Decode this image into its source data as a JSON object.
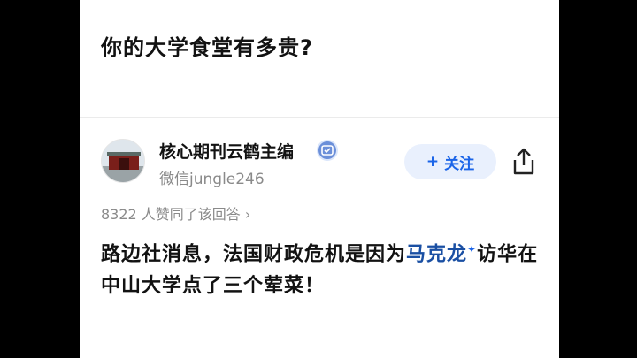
{
  "question": {
    "title": "你的大学食堂有多贵?"
  },
  "author": {
    "name": "核心期刊云鹤主编",
    "handle": "微信jungle246",
    "verified_icon": "verified-badge-icon"
  },
  "actions": {
    "follow_plus": "+",
    "follow_label": "关注",
    "share_icon": "share-icon"
  },
  "stats": {
    "upvote_text": "8322 人赞同了该回答",
    "chevron": "›"
  },
  "answer": {
    "part1": "路边社消息，法国财政危机是因为",
    "link_text": "马克龙",
    "spark": "✦",
    "part2": "访华在中山大学点了三个荤菜！"
  },
  "colors": {
    "accent": "#1a64e8",
    "link": "#1a4fa3",
    "follow_bg": "#e9f0fd"
  }
}
